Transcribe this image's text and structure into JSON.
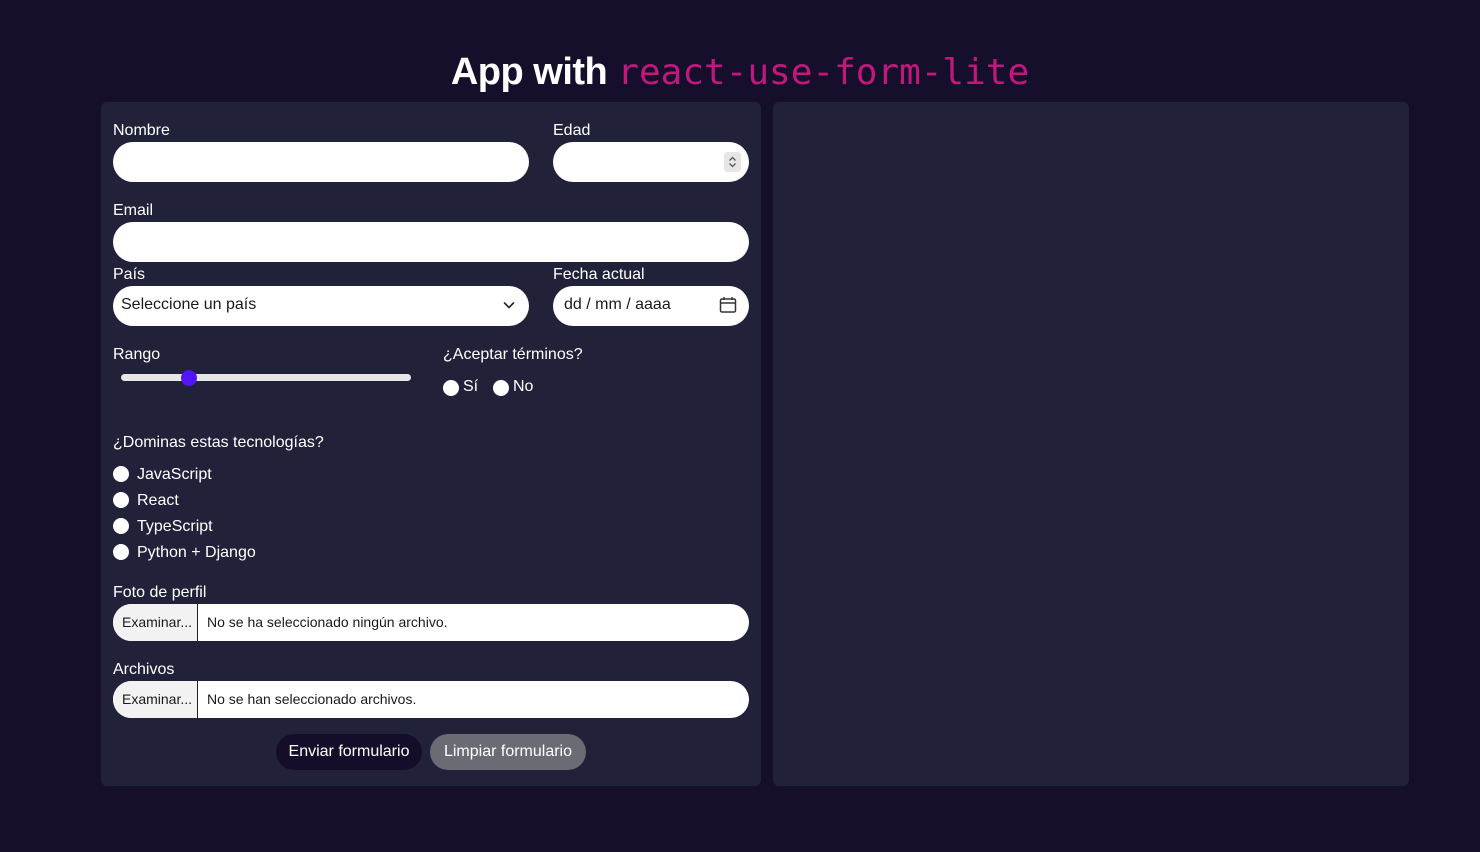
{
  "header": {
    "title_prefix": "App with",
    "title_code": "react-use-form-lite"
  },
  "form": {
    "nombre": {
      "label": "Nombre",
      "value": ""
    },
    "edad": {
      "label": "Edad",
      "value": ""
    },
    "email": {
      "label": "Email",
      "value": ""
    },
    "pais": {
      "label": "País",
      "selected": "Seleccione un país"
    },
    "fecha": {
      "label": "Fecha actual",
      "placeholder": "dd / mm / aaaa"
    },
    "rango": {
      "label": "Rango",
      "value": 0.22
    },
    "terminos": {
      "label": "¿Aceptar términos?",
      "options": [
        {
          "label": "Sí",
          "checked": false
        },
        {
          "label": "No",
          "checked": false
        }
      ]
    },
    "tecnologias": {
      "label": "¿Dominas estas tecnologías?",
      "options": [
        {
          "label": "JavaScript",
          "checked": false
        },
        {
          "label": "React",
          "checked": false
        },
        {
          "label": "TypeScript",
          "checked": false
        },
        {
          "label": "Python + Django",
          "checked": false
        }
      ]
    },
    "foto": {
      "label": "Foto de perfil",
      "button": "Examinar...",
      "status": "No se ha seleccionado ningún archivo."
    },
    "archivos": {
      "label": "Archivos",
      "button": "Examinar...",
      "status": "No se han seleccionado archivos."
    },
    "actions": {
      "submit": "Enviar formulario",
      "reset": "Limpiar formulario"
    }
  },
  "colors": {
    "background": "#150f2b",
    "panel": "#21213a",
    "accent_code": "#c0187c",
    "range_thumb": "#5415f6",
    "submit_button": "#160d2b",
    "reset_button": "#6b6b75"
  }
}
